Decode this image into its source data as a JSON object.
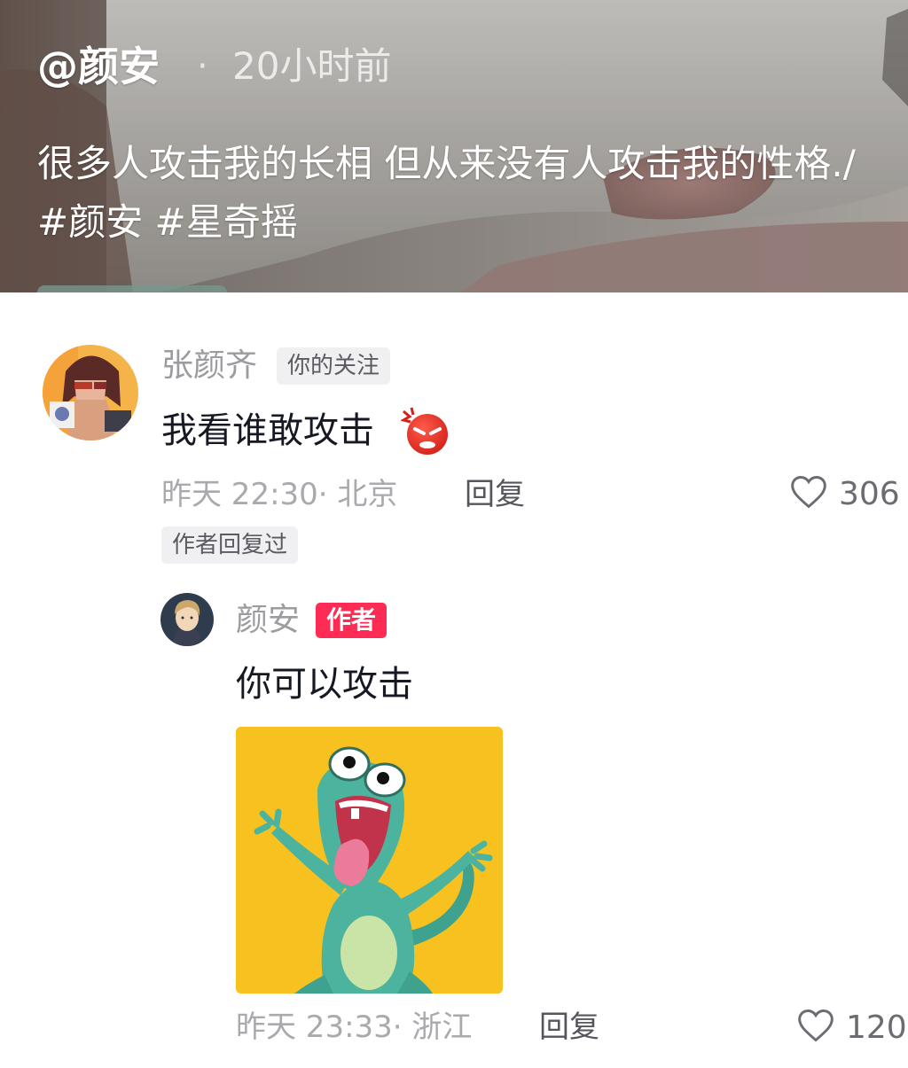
{
  "video": {
    "author": "@颜安",
    "dot": "·",
    "time": "20小时前",
    "caption": "很多人攻击我的长相 但从来没有人攻击我的性格./ #颜安 #星奇摇"
  },
  "comment": {
    "username": "张颜齐",
    "follow_tag": "你的关注",
    "text": "我看谁敢攻击",
    "emoji": "angry-face-emoji",
    "meta": "昨天 22:30· 北京",
    "reply_label": "回复",
    "like_count": "306",
    "author_replied_tag": "作者回复过"
  },
  "reply": {
    "username": "颜安",
    "author_tag": "作者",
    "text": "你可以攻击",
    "sticker": "green-lizard-sticker",
    "meta": "昨天 23:33· 浙江",
    "reply_label": "回复",
    "like_count": "120"
  },
  "colors": {
    "accent": "#fe2c55",
    "text_primary": "#161823",
    "text_secondary": "#9b9ba0",
    "sticker_bg": "#f7c21f"
  }
}
